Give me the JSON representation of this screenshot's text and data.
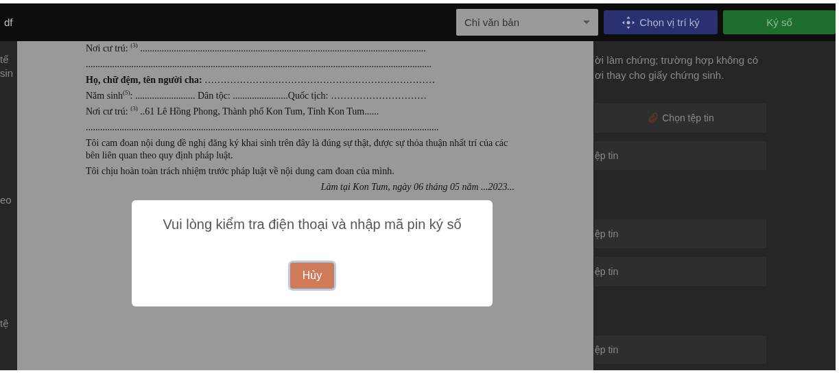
{
  "background": {
    "left_fragments": [
      "tế",
      "sin",
      "eo",
      "tệ"
    ],
    "note_lines": [
      "ời làm chứng; trường hợp không có",
      "ơi thay cho giấy chứng sinh."
    ],
    "upload_groups": [
      [
        {
          "kind": "button",
          "label": "Chọn tệp tin"
        },
        {
          "kind": "cut",
          "label": "ệp tin"
        }
      ],
      [
        {
          "kind": "cut",
          "label": "ệp tin"
        },
        {
          "kind": "cut",
          "label": "ệp tin"
        }
      ],
      [
        {
          "kind": "cut",
          "label": "ệp tin"
        }
      ]
    ]
  },
  "viewer": {
    "title": "df",
    "select": {
      "value": "Chỉ văn bản"
    },
    "buttons": [
      {
        "kind": "position",
        "label": "Chọn vị trí ký"
      },
      {
        "kind": "sign",
        "label": "Ký số"
      }
    ],
    "lines": [
      {
        "kind": "line",
        "text": "Nơi cư trú: $^{(3)}$ ......................................................................................................................."
      },
      {
        "kind": "line",
        "text": "................................................................................................................................................"
      },
      {
        "kind": "line",
        "text": "**Họ, chữ đệm, tên người cha:** ………………………………………………………………"
      },
      {
        "kind": "line",
        "text": "Năm sinh$^{(5)}$: ......................... Dân tộc: .......................Quốc tịch: …………………………"
      },
      {
        "kind": "line",
        "text": "Nơi cư trú: $^{(3)}$ ..61 Lê Hồng Phong, Thành phố Kon Tum, Tỉnh Kon Tum......"
      },
      {
        "kind": "line",
        "text": "..................................................................................................................................................."
      },
      {
        "kind": "line",
        "text": "Tôi cam đoan nội dung đề nghị đăng ký khai sinh trên đây là đúng sự thật, được sự thỏa thuận nhất trí của các bên liên quan theo quy định pháp luật."
      },
      {
        "kind": "line",
        "text": "Tôi chịu hoàn toàn trách nhiệm trước pháp luật về nội dung cam đoan của mình."
      },
      {
        "kind": "signed",
        "text": "Làm tại Kon Tum, ngày 06 tháng 05 năm ...2023..."
      }
    ]
  },
  "dialog": {
    "message": "Vui lòng kiểm tra điện thoại và nhập mã pin ký số",
    "button": "Hủy"
  }
}
